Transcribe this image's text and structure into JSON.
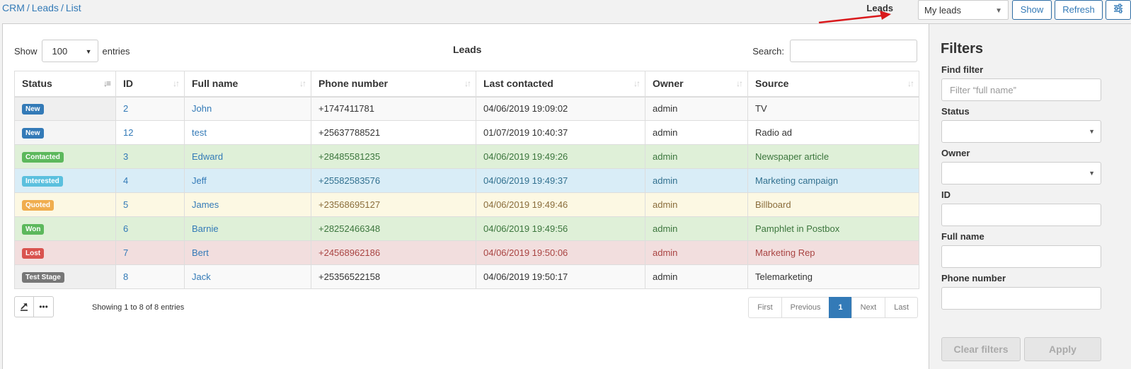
{
  "breadcrumb": [
    "CRM",
    "Leads",
    "List"
  ],
  "topbar": {
    "leads_label": "Leads",
    "view_select": "My leads",
    "show_label": "Show",
    "refresh_label": "Refresh",
    "settings_icon": "sliders-icon"
  },
  "table_controls": {
    "show_label": "Show",
    "entries_value": "100",
    "entries_label": "entries",
    "title": "Leads",
    "search_label": "Search:"
  },
  "columns": [
    "Status",
    "ID",
    "Full name",
    "Phone number",
    "Last contacted",
    "Owner",
    "Source"
  ],
  "rows": [
    {
      "status": "New",
      "status_color": "#337ab7",
      "id": "2",
      "name": "John",
      "phone": "+1747411781",
      "last": "04/06/2019 19:09:02",
      "owner": "admin",
      "source": "TV",
      "row_class": "row-odd"
    },
    {
      "status": "New",
      "status_color": "#337ab7",
      "id": "12",
      "name": "test",
      "phone": "+25637788521",
      "last": "01/07/2019 10:40:37",
      "owner": "admin",
      "source": "Radio ad",
      "row_class": "row-default"
    },
    {
      "status": "Contacted",
      "status_color": "#5cb85c",
      "id": "3",
      "name": "Edward",
      "phone": "+28485581235",
      "last": "04/06/2019 19:49:26",
      "owner": "admin",
      "source": "Newspaper article",
      "row_class": "row-success"
    },
    {
      "status": "Interested",
      "status_color": "#5bc0de",
      "id": "4",
      "name": "Jeff",
      "phone": "+25582583576",
      "last": "04/06/2019 19:49:37",
      "owner": "admin",
      "source": "Marketing campaign",
      "row_class": "row-info"
    },
    {
      "status": "Quoted",
      "status_color": "#f0ad4e",
      "id": "5",
      "name": "James",
      "phone": "+23568695127",
      "last": "04/06/2019 19:49:46",
      "owner": "admin",
      "source": "Billboard",
      "row_class": "row-warning"
    },
    {
      "status": "Won",
      "status_color": "#5cb85c",
      "id": "6",
      "name": "Barnie",
      "phone": "+28252466348",
      "last": "04/06/2019 19:49:56",
      "owner": "admin",
      "source": "Pamphlet in Postbox",
      "row_class": "row-success"
    },
    {
      "status": "Lost",
      "status_color": "#d9534f",
      "id": "7",
      "name": "Bert",
      "phone": "+24568962186",
      "last": "04/06/2019 19:50:06",
      "owner": "admin",
      "source": "Marketing Rep",
      "row_class": "row-danger"
    },
    {
      "status": "Test Stage",
      "status_color": "#777777",
      "id": "8",
      "name": "Jack",
      "phone": "+25356522158",
      "last": "04/06/2019 19:50:17",
      "owner": "admin",
      "source": "Telemarketing",
      "row_class": "row-odd"
    }
  ],
  "footer": {
    "export_icon": "export-icon",
    "more_icon": "ellipsis-icon",
    "info": "Showing 1 to 8 of 8 entries",
    "pagination": [
      "First",
      "Previous",
      "1",
      "Next",
      "Last"
    ],
    "active_page": "1"
  },
  "filters": {
    "title": "Filters",
    "find_filter_label": "Find filter",
    "find_filter_placeholder": "Filter “full name”",
    "status_label": "Status",
    "owner_label": "Owner",
    "id_label": "ID",
    "full_name_label": "Full name",
    "phone_label": "Phone number",
    "clear_label": "Clear filters",
    "apply_label": "Apply"
  }
}
